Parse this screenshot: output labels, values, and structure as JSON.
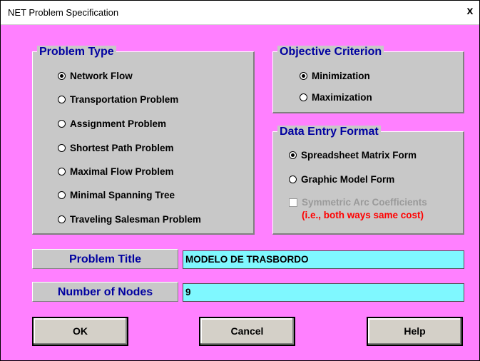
{
  "window": {
    "title": "NET Problem Specification",
    "close_glyph": "x"
  },
  "problem_type": {
    "title": "Problem Type",
    "options": [
      {
        "label": "Network Flow",
        "checked": true
      },
      {
        "label": "Transportation Problem",
        "checked": false
      },
      {
        "label": "Assignment Problem",
        "checked": false
      },
      {
        "label": "Shortest Path Problem",
        "checked": false
      },
      {
        "label": "Maximal Flow Problem",
        "checked": false
      },
      {
        "label": "Minimal Spanning Tree",
        "checked": false
      },
      {
        "label": "Traveling Salesman Problem",
        "checked": false
      }
    ]
  },
  "objective": {
    "title": "Objective Criterion",
    "options": [
      {
        "label": "Minimization",
        "checked": true
      },
      {
        "label": "Maximization",
        "checked": false
      }
    ]
  },
  "data_entry": {
    "title": "Data Entry Format",
    "options": [
      {
        "label": "Spreadsheet Matrix Form",
        "checked": true
      },
      {
        "label": "Graphic Model Form",
        "checked": false
      }
    ],
    "symmetric_label": "Symmetric Arc Coefficients",
    "symmetric_note": "(i.e., both ways same cost)",
    "symmetric_checked": false
  },
  "fields": {
    "title_label": "Problem Title",
    "title_value": "MODELO DE TRASBORDO",
    "nodes_label": "Number of Nodes",
    "nodes_value": "9"
  },
  "buttons": {
    "ok": "OK",
    "cancel": "Cancel",
    "help": "Help"
  },
  "colors": {
    "background": "#ff80ff",
    "group_bg": "#c8c8c8",
    "heading": "#0000a0",
    "input_bg": "#7ff8ff",
    "note": "#ff0000"
  }
}
